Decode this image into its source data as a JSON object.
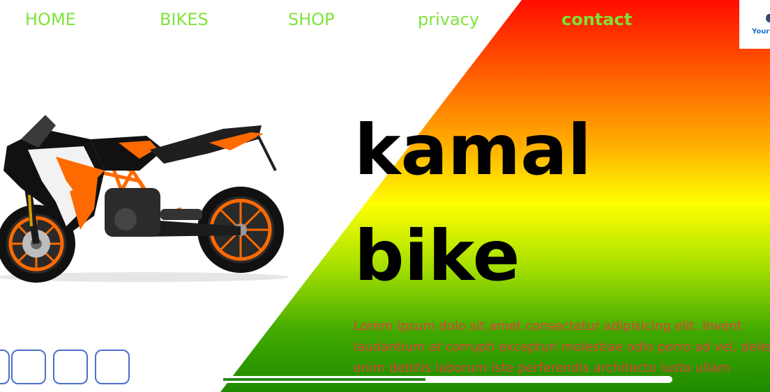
{
  "nav": {
    "items": [
      {
        "label": "HOME"
      },
      {
        "label": "BIKES"
      },
      {
        "label": "SHOP"
      },
      {
        "label": "privacy"
      },
      {
        "label": "contact"
      }
    ],
    "active_index": 4
  },
  "logo": {
    "text": "YourC"
  },
  "hero": {
    "title_line1": "kamal",
    "title_line2": "bike",
    "body": "Lorem ipsum dolo sit amet consectetur adipisicing elit. Invent laudantium at corrupti excepturi molestiae odio porro ad vel, deleniti enim debitis laborum iste perferendis architecto iusto ullam"
  },
  "thumbnails": {
    "count": 4
  },
  "progress": {
    "fraction": 0.45
  },
  "colors": {
    "nav_text": "#7fe33a",
    "body_text": "#e0413a",
    "thumb_border": "#4b6fcf"
  }
}
